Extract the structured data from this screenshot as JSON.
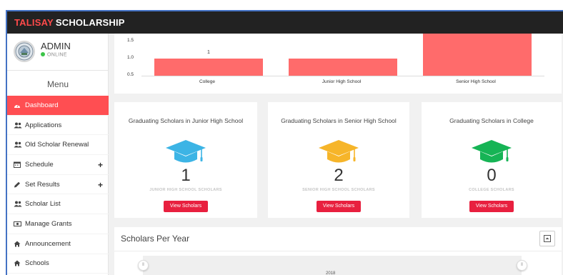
{
  "app": {
    "brand_part1": "TALISAY",
    "brand_part2": "SCHOLARSHIP",
    "accent_color": "#ff4e52"
  },
  "user": {
    "name": "ADMIN",
    "status": "ONLINE"
  },
  "sidebar": {
    "menu_title": "Menu",
    "items": [
      {
        "label": "Dashboard",
        "icon": "dashboard-icon",
        "active": true
      },
      {
        "label": "Applications",
        "icon": "users-icon"
      },
      {
        "label": "Old Scholar Renewal",
        "icon": "users-icon"
      },
      {
        "label": "Schedule",
        "icon": "calendar-icon",
        "expandable": true
      },
      {
        "label": "Set Results",
        "icon": "pencil-icon",
        "expandable": true
      },
      {
        "label": "Scholar List",
        "icon": "users-icon"
      },
      {
        "label": "Manage Grants",
        "icon": "money-icon"
      },
      {
        "label": "Announcement",
        "icon": "home-icon"
      },
      {
        "label": "Schools",
        "icon": "home-icon"
      }
    ],
    "plus_symbol": "+"
  },
  "chart_data": {
    "type": "bar",
    "categories": [
      "College",
      "Junior High School",
      "Senior High School"
    ],
    "values": [
      1,
      1,
      2
    ],
    "data_labels": [
      "1",
      "",
      ""
    ],
    "y_ticks": [
      "1.5",
      "1.0",
      "0.5"
    ],
    "ylim": [
      0.5,
      1.5
    ],
    "bar_color": "#ff6b6b"
  },
  "stats": [
    {
      "title": "Graduating Scholars in Junior High School",
      "count": "1",
      "label": "JUNIOR HIGH SCHOOL SCHOLARS",
      "button": "View Scholars",
      "color": "#3cb4e5",
      "icon": "graduation-cap-icon"
    },
    {
      "title": "Graduating Scholars in Senior High School",
      "count": "2",
      "label": "SENIOR HIGH SCHOOL SCHOLARS",
      "button": "View Scholars",
      "color": "#f6b52a",
      "icon": "graduation-cap-icon"
    },
    {
      "title": "Graduating Scholars in College",
      "count": "0",
      "label": "COLLEGE SCHOLARS",
      "button": "View Scholars",
      "color": "#16b455",
      "icon": "graduation-cap-icon"
    }
  ],
  "scholars_per_year": {
    "title": "Scholars Per Year",
    "handle_symbol": "⦀",
    "year": "2018"
  }
}
